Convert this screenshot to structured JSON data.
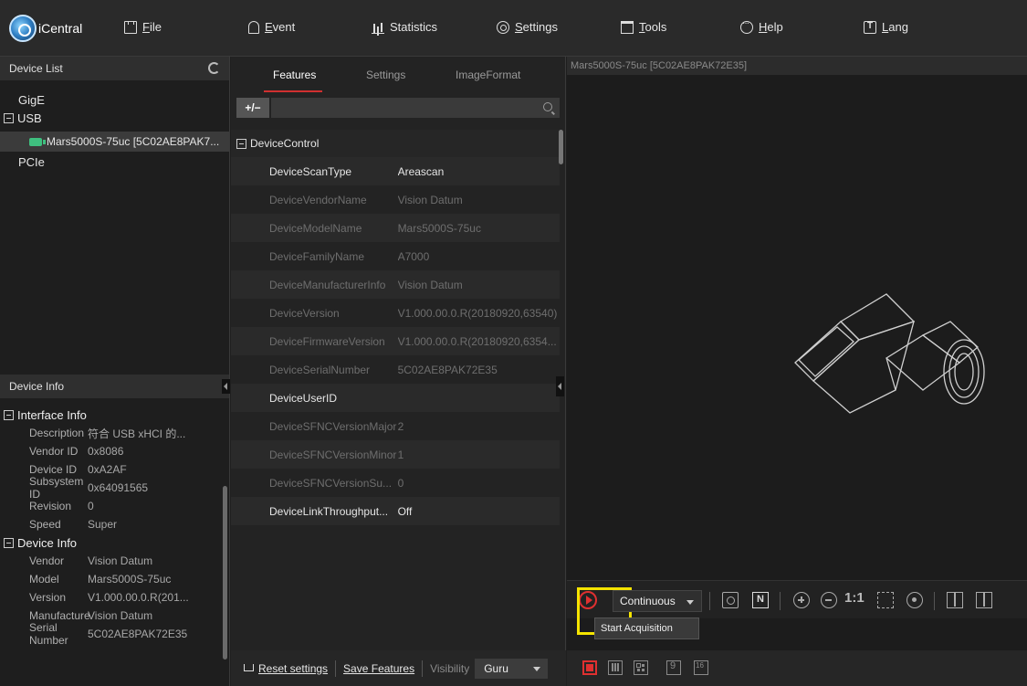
{
  "app": {
    "logo_text": "iCentral"
  },
  "menu": [
    {
      "label": "File",
      "icon": "file-icon"
    },
    {
      "label": "Event",
      "icon": "bell-icon"
    },
    {
      "label": "Statistics",
      "icon": "bar-chart-icon"
    },
    {
      "label": "Settings",
      "icon": "gear-icon"
    },
    {
      "label": "Tools",
      "icon": "toolbox-icon"
    },
    {
      "label": "Help",
      "icon": "help-icon"
    },
    {
      "label": "Lang",
      "icon": "language-icon"
    }
  ],
  "device_list": {
    "title": "Device List",
    "groups": [
      "GigE",
      "USB",
      "PCIe"
    ],
    "selected_device": "Mars5000S-75uc [5C02AE8PAK7..."
  },
  "device_info": {
    "title": "Device Info",
    "interface_section": "Interface Info",
    "interface_rows": [
      {
        "k": "Description",
        "v": "符合 USB xHCI 的..."
      },
      {
        "k": "Vendor ID",
        "v": "0x8086"
      },
      {
        "k": "Device ID",
        "v": "0xA2AF"
      },
      {
        "k": "Subsystem ID",
        "v": "0x64091565"
      },
      {
        "k": "Revision",
        "v": "0"
      },
      {
        "k": "Speed",
        "v": "Super"
      }
    ],
    "device_section": "Device Info",
    "device_rows": [
      {
        "k": "Vendor",
        "v": "Vision Datum"
      },
      {
        "k": "Model",
        "v": "Mars5000S-75uc"
      },
      {
        "k": "Version",
        "v": "V1.000.00.0.R(201..."
      },
      {
        "k": "Manufacture",
        "v": "Vision Datum"
      },
      {
        "k": "Serial Number",
        "v": "5C02AE8PAK72E35"
      }
    ]
  },
  "feature_tabs": [
    "Features",
    "Settings",
    "ImageFormat"
  ],
  "feature_toolbar": {
    "expand_collapse": "+/−",
    "search_placeholder": ""
  },
  "feature_group": "DeviceControl",
  "features": [
    {
      "name": "DeviceScanType",
      "value": "Areascan",
      "style": "bright"
    },
    {
      "name": "DeviceVendorName",
      "value": "Vision Datum",
      "style": "dim"
    },
    {
      "name": "DeviceModelName",
      "value": "Mars5000S-75uc",
      "style": "dim"
    },
    {
      "name": "DeviceFamilyName",
      "value": "A7000",
      "style": "dim"
    },
    {
      "name": "DeviceManufacturerInfo",
      "value": "Vision Datum",
      "style": "dim"
    },
    {
      "name": "DeviceVersion",
      "value": "V1.000.00.0.R(20180920,63540)",
      "style": "dim"
    },
    {
      "name": "DeviceFirmwareVersion",
      "value": "V1.000.00.0.R(20180920,6354...",
      "style": "dim"
    },
    {
      "name": "DeviceSerialNumber",
      "value": "5C02AE8PAK72E35",
      "style": "dim"
    },
    {
      "name": "DeviceUserID",
      "value": "",
      "style": "bright"
    },
    {
      "name": "DeviceSFNCVersionMajor",
      "value": "2",
      "style": "dim"
    },
    {
      "name": "DeviceSFNCVersionMinor",
      "value": "1",
      "style": "dim"
    },
    {
      "name": "DeviceSFNCVersionSu...",
      "value": "0",
      "style": "dim"
    },
    {
      "name": "DeviceLinkThroughput...",
      "value": "Off",
      "style": "bright"
    }
  ],
  "feature_footer": {
    "reset": "Reset settings",
    "save": "Save Features",
    "visibility_label": "Visibility",
    "visibility_value": "Guru"
  },
  "viewer": {
    "title": "Mars5000S-75uc [5C02AE8PAK72E35]",
    "acquisition_mode": "Continuous",
    "zoom_one_to_one": "1:1",
    "tooltip": "Start Acquisition"
  },
  "colors": {
    "accent": "#e03030",
    "highlight": "#f5e400"
  }
}
